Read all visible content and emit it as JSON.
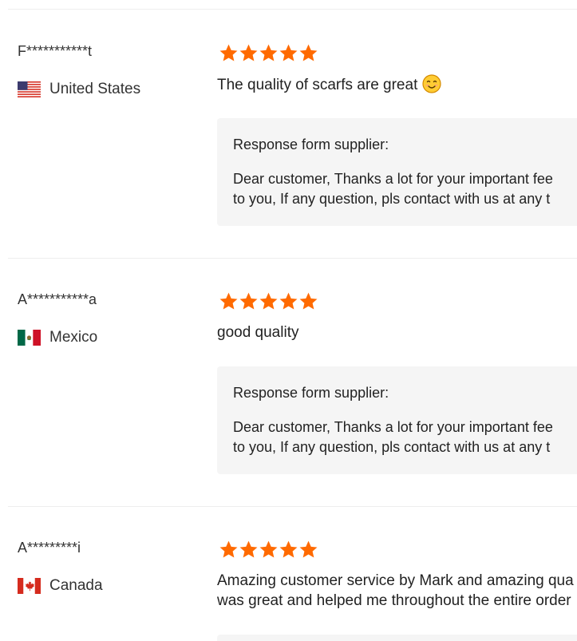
{
  "reviews": [
    {
      "reviewer": "F***********t",
      "country": "United States",
      "rating": 5,
      "text_lines": [
        "The quality of scarfs are great"
      ],
      "emoji": "smiling-face-emoji",
      "response_title": "Response form supplier:",
      "response_lines": [
        "Dear customer, Thanks a lot for your important fee",
        "to you, If any question, pls contact with us at any t"
      ]
    },
    {
      "reviewer": "A***********a",
      "country": "Mexico",
      "rating": 5,
      "text_lines": [
        "good quality"
      ],
      "response_title": "Response form supplier:",
      "response_lines": [
        "Dear customer, Thanks a lot for your important fee",
        "to you, If any question, pls contact with us at any t"
      ]
    },
    {
      "reviewer": "A*********i",
      "country": "Canada",
      "rating": 5,
      "text_lines": [
        "Amazing customer service by Mark and amazing qua",
        "was great and helped me throughout the entire order"
      ]
    }
  ],
  "colors": {
    "star": "#ff6a00",
    "response_bg": "#f5f5f5",
    "divider": "#eeeeee"
  }
}
